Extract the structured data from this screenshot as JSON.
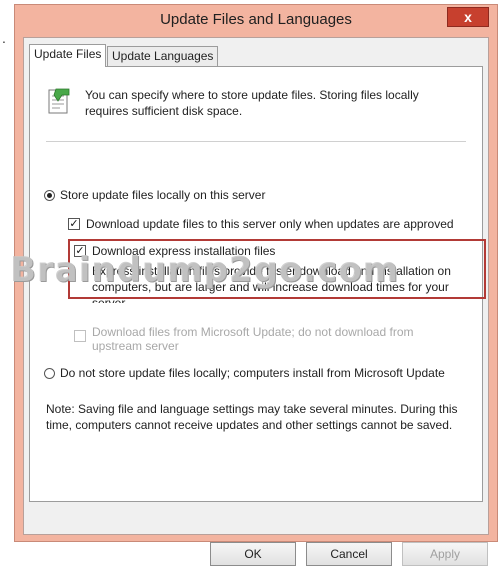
{
  "window": {
    "title": "Update Files and Languages",
    "close_label": "x"
  },
  "tabs": [
    {
      "label": "Update Files",
      "active": true
    },
    {
      "label": "Update Languages",
      "active": false
    }
  ],
  "info": {
    "text": "You can specify where to store update files. Storing files locally requires sufficient disk space."
  },
  "options": {
    "store_locally": {
      "label": "Store update files locally on this server",
      "checked": true
    },
    "approved_only": {
      "label": "Download update files to this server only when updates are approved",
      "checked": true
    },
    "express": {
      "label": "Download express installation files",
      "checked": true,
      "description": "Express installation files provide faster download and installation on computers, but are larger and will increase download times for your",
      "description_cut": "server."
    },
    "from_microsoft": {
      "label": "Download files from Microsoft Update; do not download from",
      "label2": "upstream server",
      "checked": false,
      "enabled": false
    },
    "not_store": {
      "label": "Do not store update files locally; computers install from Microsoft Update",
      "checked": false
    }
  },
  "watermark": "Braindump2go.com",
  "note": "Note: Saving file and language settings may take several minutes. During this time, computers cannot receive updates and other settings cannot be saved.",
  "buttons": {
    "ok": "OK",
    "cancel": "Cancel",
    "apply": "Apply"
  },
  "leading_mark": ".",
  "colors": {
    "title_bar": "#f3b4a0",
    "close_button": "#c7402e",
    "highlight_border": "#b23a36"
  }
}
